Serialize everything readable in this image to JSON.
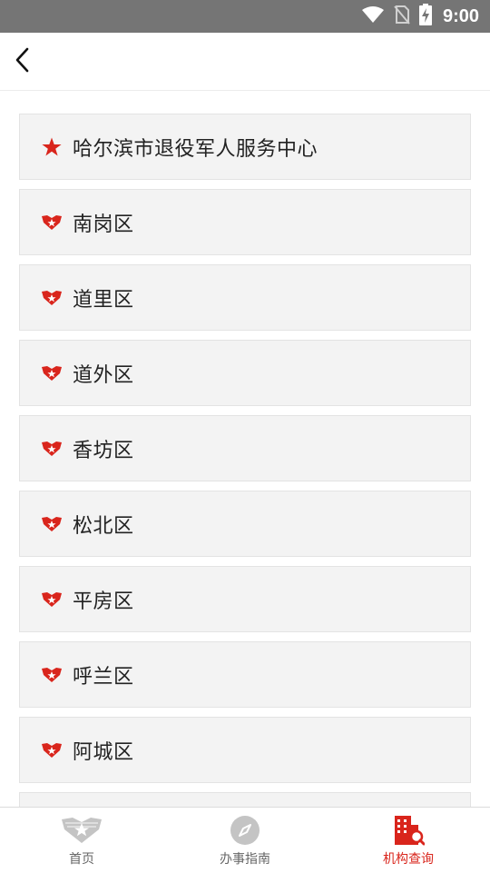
{
  "status_bar": {
    "time": "9:00",
    "icons": [
      "wifi-icon",
      "no-sim-icon",
      "battery-charging-icon"
    ]
  },
  "app_bar": {
    "back_icon": "chevron-left-icon"
  },
  "list": {
    "items": [
      {
        "label": "哈尔滨市退役军人服务中心",
        "icon": "star-icon"
      },
      {
        "label": "南岗区",
        "icon": "veteran-emblem-icon"
      },
      {
        "label": "道里区",
        "icon": "veteran-emblem-icon"
      },
      {
        "label": "道外区",
        "icon": "veteran-emblem-icon"
      },
      {
        "label": "香坊区",
        "icon": "veteran-emblem-icon"
      },
      {
        "label": "松北区",
        "icon": "veteran-emblem-icon"
      },
      {
        "label": "平房区",
        "icon": "veteran-emblem-icon"
      },
      {
        "label": "呼兰区",
        "icon": "veteran-emblem-icon"
      },
      {
        "label": "阿城区",
        "icon": "veteran-emblem-icon"
      }
    ]
  },
  "bottom_nav": {
    "items": [
      {
        "label": "首页",
        "icon": "home-emblem-icon",
        "active": false
      },
      {
        "label": "办事指南",
        "icon": "compass-icon",
        "active": false
      },
      {
        "label": "机构查询",
        "icon": "building-search-icon",
        "active": true
      }
    ]
  },
  "colors": {
    "accent": "#d9251c",
    "status_bar": "#757575",
    "row_background": "#f3f3f3",
    "inactive": "#9e9e9e"
  }
}
